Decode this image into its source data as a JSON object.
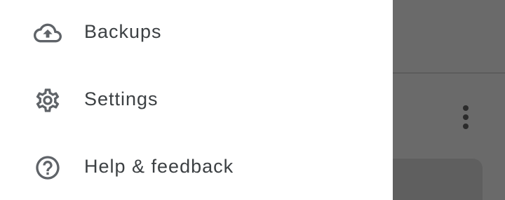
{
  "drawer": {
    "items": [
      {
        "label": "Backups",
        "icon": "cloud-upload-icon"
      },
      {
        "label": "Settings",
        "icon": "gear-icon"
      },
      {
        "label": "Help & feedback",
        "icon": "help-circle-icon"
      }
    ]
  },
  "background": {
    "overflow_menu_icon": "more-vert-icon"
  },
  "colors": {
    "text": "#3c4043",
    "icon": "#5f6368",
    "scrim": "#6a6a6a"
  }
}
